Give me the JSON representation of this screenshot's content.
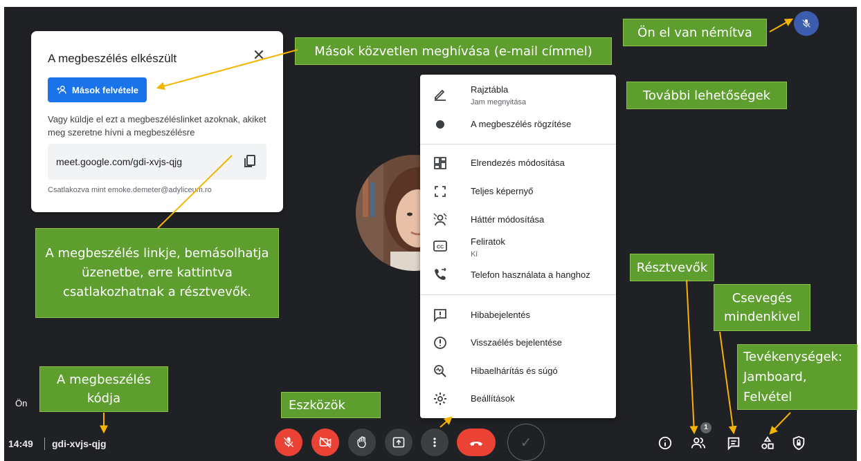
{
  "ready_card": {
    "title": "A megbeszélés elkészült",
    "add_button": "Mások felvétele",
    "description": "Vagy küldje el ezt a megbeszéléslinket azoknak, akiket meg szeretne hívni a megbeszélésre",
    "link": "meet.google.com/gdi-xvjs-qjg",
    "joined_as": "Csatlakozva mint emoke.demeter@adyliceum.ro"
  },
  "menu": {
    "items": [
      {
        "label": "Rajztábla",
        "sub": "Jam megnyitása",
        "icon": "pen-icon"
      },
      {
        "label": "A megbeszélés rögzítése",
        "icon": "record-icon"
      },
      {
        "label": "Elrendezés módosítása",
        "icon": "layout-icon"
      },
      {
        "label": "Teljes képernyő",
        "icon": "fullscreen-icon"
      },
      {
        "label": "Háttér módosítása",
        "icon": "background-icon"
      },
      {
        "label": "Feliratok",
        "sub": "Ki",
        "icon": "captions-icon"
      },
      {
        "label": "Telefon használata a hanghoz",
        "icon": "phone-icon"
      },
      {
        "label": "Hibabejelentés",
        "icon": "feedback-icon"
      },
      {
        "label": "Visszaélés bejelentése",
        "icon": "report-icon"
      },
      {
        "label": "Hibaelhárítás és súgó",
        "icon": "troubleshoot-icon"
      },
      {
        "label": "Beállítások",
        "icon": "settings-icon"
      }
    ]
  },
  "bottom": {
    "time": "14:49",
    "separator": "|",
    "meeting_code": "gdi-xvjs-qjg",
    "self_label": "Ön",
    "participants_count": "1"
  },
  "annotations": {
    "muted": "Ön el van némítva",
    "invite": "Mások közvetlen meghívása (e-mail címmel)",
    "more_options": "További lehetőségek",
    "link_info": "A megbeszélés linkje, bemásolhatja üzenetbe, erre kattintva csatlakozhatnak a résztvevők.",
    "participants": "Résztvevők",
    "chat": "Csevegés mindenkivel",
    "activities": "Tevékenységek: Jamboard, Felvétel",
    "code": "A megbeszélés kódja",
    "tools": "Eszközök"
  },
  "colors": {
    "background": "#202124",
    "accent_blue": "#1a73e8",
    "red": "#ea4335",
    "callout_green": "#5d9e2f",
    "arrow": "#f4b400"
  }
}
